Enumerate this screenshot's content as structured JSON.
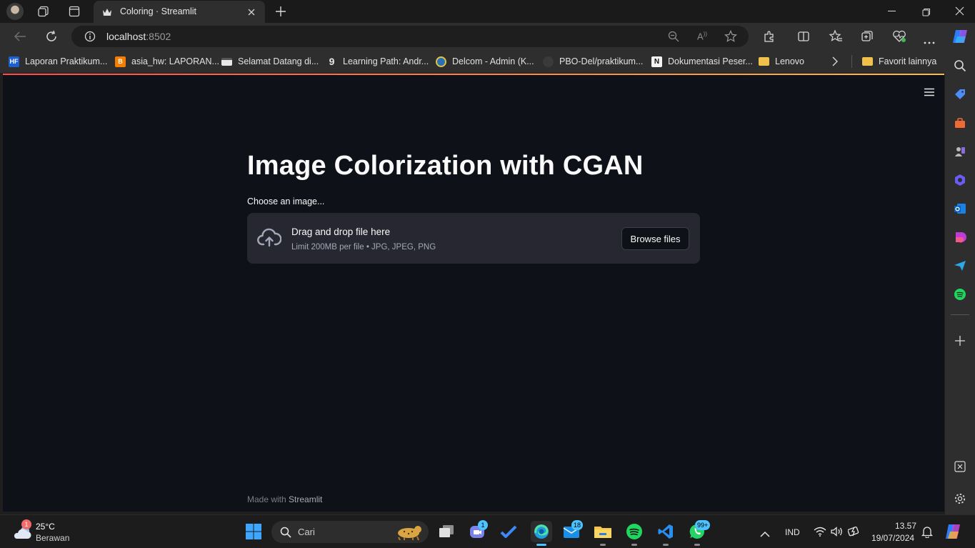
{
  "browser": {
    "tab_title": "Coloring · Streamlit",
    "url_host": "localhost",
    "url_port": ":8502",
    "favorites": [
      {
        "label": "Laporan Praktikum...",
        "icon": "hf-icon"
      },
      {
        "label": "asia_hw: LAPORAN...",
        "icon": "blogger-icon"
      },
      {
        "label": "Selamat Datang di...",
        "icon": "page-icon"
      },
      {
        "label": "Learning Path: Andr...",
        "icon": "dicoding-icon"
      },
      {
        "label": "Delcom - Admin (K...",
        "icon": "delcom-icon"
      },
      {
        "label": "PBO-Del/praktikum...",
        "icon": "github-icon"
      },
      {
        "label": "Dokumentasi Peser...",
        "icon": "notion-icon"
      },
      {
        "label": "Lenovo",
        "icon": "folder-icon"
      }
    ],
    "favorites_more": "Favorit lainnya"
  },
  "app": {
    "title": "Image Colorization with CGAN",
    "uploader_label": "Choose an image...",
    "drop_main": "Drag and drop file here",
    "drop_sub": "Limit 200MB per file • JPG, JPEG, PNG",
    "browse_label": "Browse files",
    "footer_prefix": "Made with ",
    "footer_brand": "Streamlit"
  },
  "taskbar": {
    "weather_temp": "25°C",
    "weather_desc": "Berawan",
    "weather_badge": "1",
    "search_placeholder": "Cari",
    "meet_badge": "1",
    "mail_badge": "18",
    "whatsapp_badge": "99+",
    "language": "IND",
    "time": "13.57",
    "date": "19/07/2024"
  },
  "colors": {
    "app_bg": "#0e1117",
    "dropzone_bg": "#262730",
    "accent_red": "#ff4b4b",
    "accent_yellow": "#ffbd45"
  }
}
